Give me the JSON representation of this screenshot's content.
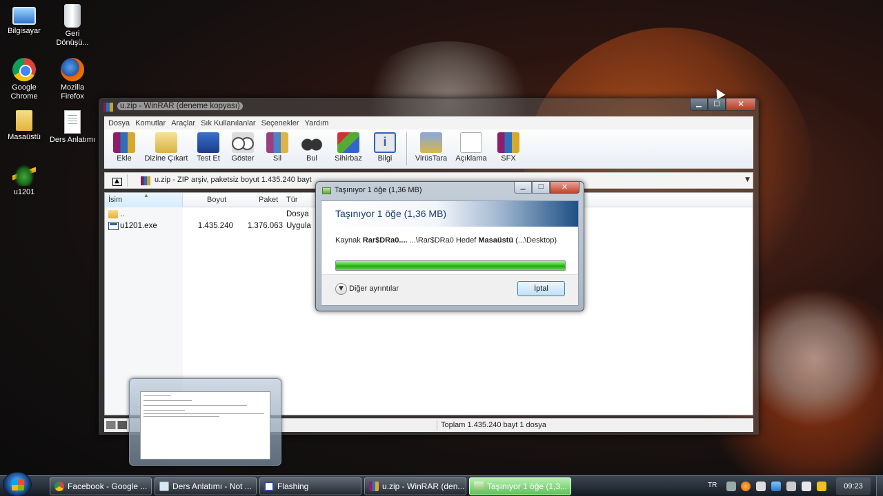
{
  "desktop": {
    "icons": [
      {
        "label": "Bilgisayar",
        "icon": "computer-icon"
      },
      {
        "label": "Geri Dönüşü...",
        "icon": "recycle-bin-icon"
      },
      {
        "label": "Google Chrome",
        "icon": "chrome-icon"
      },
      {
        "label": "Mozilla Firefox",
        "icon": "firefox-icon"
      },
      {
        "label": "Masaüstü",
        "icon": "folder-icon"
      },
      {
        "label": "Ders Anlatımı",
        "icon": "document-icon"
      },
      {
        "label": "u1201",
        "icon": "u1201-icon"
      }
    ]
  },
  "winrar": {
    "title": "u.zip - WinRAR (deneme kopyası)",
    "menu": [
      "Dosya",
      "Komutlar",
      "Araçlar",
      "Sık Kullanılanlar",
      "Seçenekler",
      "Yardım"
    ],
    "toolbar": [
      {
        "label": "Ekle",
        "icon": "add-archive-icon"
      },
      {
        "label": "Dizine Çıkart",
        "icon": "extract-folder-icon"
      },
      {
        "label": "Test Et",
        "icon": "test-icon"
      },
      {
        "label": "Göster",
        "icon": "view-glasses-icon"
      },
      {
        "label": "Sil",
        "icon": "delete-icon"
      },
      {
        "label": "Bul",
        "icon": "binoculars-icon"
      },
      {
        "label": "Sihirbaz",
        "icon": "wizard-icon"
      },
      {
        "label": "Bilgi",
        "icon": "info-icon"
      },
      {
        "label": "VirüsTara",
        "icon": "virus-scan-icon"
      },
      {
        "label": "Açıklama",
        "icon": "comment-icon"
      },
      {
        "label": "SFX",
        "icon": "sfx-icon"
      }
    ],
    "address": "u.zip - ZIP arşiv, paketsiz boyut 1.435.240 bayt",
    "columns": {
      "name": "İsim",
      "size": "Boyut",
      "packed": "Paket",
      "type": "Tür"
    },
    "rows": [
      {
        "name": "..",
        "size": "",
        "packed": "",
        "type": "Dosya",
        "icon": "folder-icon"
      },
      {
        "name": "u1201.exe",
        "size": "1.435.240",
        "packed": "1.376.063",
        "type": "Uygula",
        "icon": "exe-icon"
      }
    ],
    "status": "Toplam 1.435.240 bayt 1 dosya"
  },
  "dialog": {
    "title": "Taşınıyor 1 öğe (1,36 MB)",
    "banner": "Taşınıyor 1 öğe (1,36 MB)",
    "source_label": "Kaynak",
    "source_value": "Rar$DRa0....",
    "source_path": "...\\Rar$DRa0",
    "target_label": "Hedef",
    "target_value": "Masaüstü",
    "target_path": "(...\\Desktop)",
    "progress": 1.0,
    "more_details": "Diğer ayrıntılar",
    "cancel": "İptal"
  },
  "taskbar": {
    "buttons": [
      {
        "label": "Facebook - Google ...",
        "icon": "chrome-icon"
      },
      {
        "label": "Ders Anlatımı - Not ...",
        "icon": "notepad-icon"
      },
      {
        "label": "Flashing",
        "icon": "flashing-icon"
      },
      {
        "label": "u.zip - WinRAR (den...",
        "icon": "winrar-icon"
      },
      {
        "label": "Taşınıyor 1 öğe (1,3...",
        "icon": "move-icon"
      }
    ],
    "language": "TR",
    "clock": "09:23"
  }
}
